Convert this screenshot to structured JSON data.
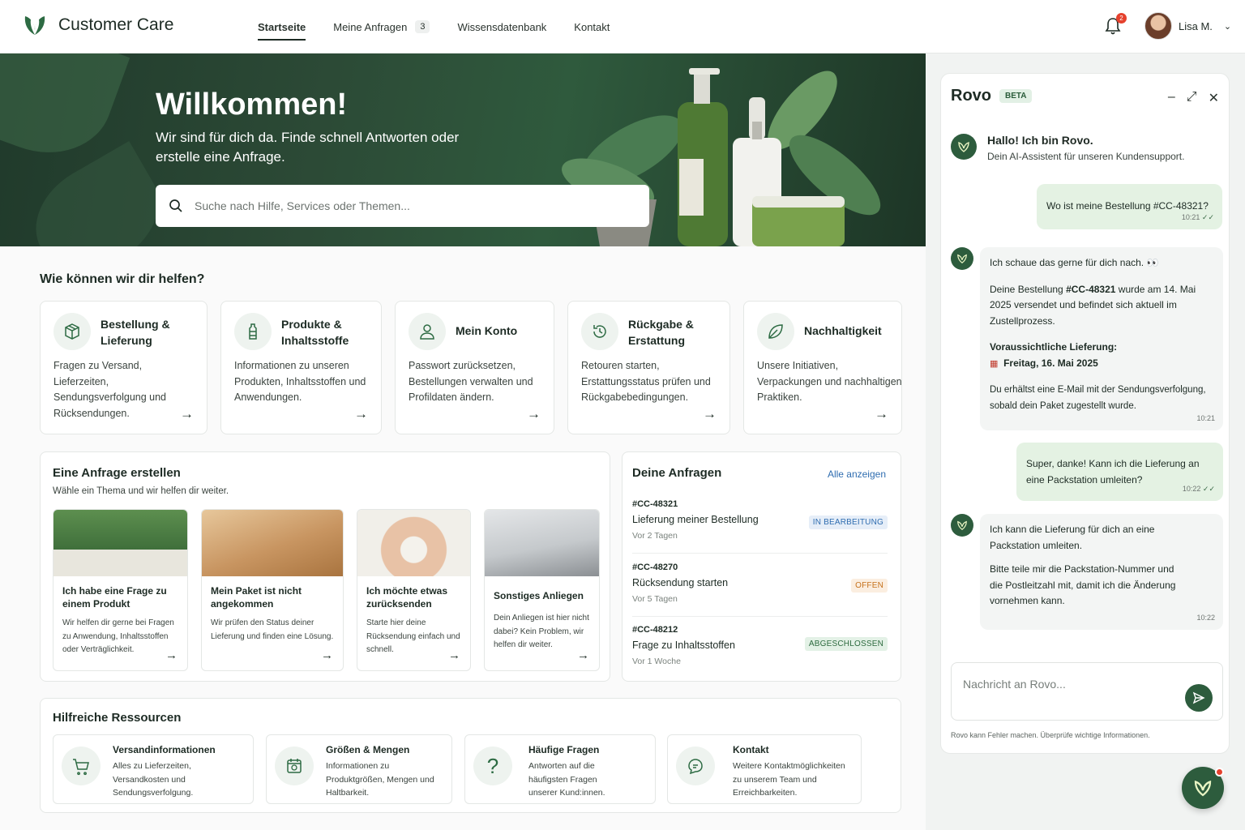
{
  "header": {
    "brand": "Customer Care",
    "nav": [
      {
        "label": "Startseite",
        "active": true
      },
      {
        "label": "Meine Anfragen",
        "badge": "3"
      },
      {
        "label": "Wissensdatenbank"
      },
      {
        "label": "Kontakt"
      }
    ],
    "notifications_count": "2",
    "user_name": "Lisa M."
  },
  "hero": {
    "title": "Willkommen!",
    "subtitle": "Wir sind für dich da. Finde schnell Antworten oder erstelle eine Anfrage.",
    "search_placeholder": "Suche nach Hilfe, Services oder Themen..."
  },
  "help": {
    "title": "Wie können wir dir helfen?",
    "categories": [
      {
        "title": "Bestellung & Lieferung",
        "desc": "Fragen zu Versand, Lieferzeiten, Sendungsverfolgung und Rücksendungen.",
        "icon": "package-icon"
      },
      {
        "title": "Produkte & Inhaltsstoffe",
        "desc": "Informationen zu unseren Produkten, Inhaltsstoffen und Anwendungen.",
        "icon": "bottle-icon"
      },
      {
        "title": "Mein Konto",
        "desc": "Passwort zurücksetzen, Bestellungen verwalten und Profildaten ändern.",
        "icon": "user-icon"
      },
      {
        "title": "Rückgabe & Erstattung",
        "desc": "Retouren starten, Erstattungsstatus prüfen und Rückgabebedingungen.",
        "icon": "return-icon"
      },
      {
        "title": "Nachhaltigkeit",
        "desc": "Unsere Initiativen, Verpackungen und nachhaltigen Praktiken.",
        "icon": "leaf-icon"
      }
    ]
  },
  "create_request": {
    "title": "Eine Anfrage erstellen",
    "subtitle": "Wähle ein Thema und wir helfen dir weiter.",
    "cards": [
      {
        "title": "Ich habe eine Frage zu einem Produkt",
        "desc": "Wir helfen dir gerne bei Fragen zu Anwendung, Inhaltsstoffen oder Verträglichkeit."
      },
      {
        "title": "Mein Paket ist nicht angekommen",
        "desc": "Wir prüfen den Status deiner Lieferung und finden eine Lösung."
      },
      {
        "title": "Ich möchte etwas zurücksenden",
        "desc": "Starte hier deine Rücksendung einfach und schnell."
      },
      {
        "title": "Sonstiges Anliegen",
        "desc": "Dein Anliegen ist hier nicht dabei? Kein Problem, wir helfen dir weiter."
      }
    ]
  },
  "my_requests": {
    "title": "Deine Anfragen",
    "show_all": "Alle anzeigen",
    "items": [
      {
        "id": "#CC-48321",
        "title": "Lieferung meiner Bestellung",
        "age": "Vor 2 Tagen",
        "status": "IN BEARBEITUNG",
        "status_color": "#2f6db0",
        "status_bg": "#e6eef8"
      },
      {
        "id": "#CC-48270",
        "title": "Rücksendung starten",
        "age": "Vor 5 Tagen",
        "status": "OFFEN",
        "status_color": "#c5711c",
        "status_bg": "#fbeee0"
      },
      {
        "id": "#CC-48212",
        "title": "Frage zu Inhaltsstoffen",
        "age": "Vor 1 Woche",
        "status": "ABGESCHLOSSEN",
        "status_color": "#2c6a3e",
        "status_bg": "#e3f1e6"
      }
    ]
  },
  "resources": {
    "title": "Hilfreiche Ressourcen",
    "items": [
      {
        "title": "Versandinformationen",
        "desc": "Alles zu Lieferzeiten, Versandkosten und Sendungsverfolgung.",
        "icon": "cart-icon"
      },
      {
        "title": "Größen & Mengen",
        "desc": "Informationen zu Produktgrößen, Mengen und Haltbarkeit.",
        "icon": "calendar-icon"
      },
      {
        "title": "Häufige Fragen",
        "desc": "Antworten auf die häufigsten Fragen unserer Kund:innen.",
        "icon": "question-icon"
      },
      {
        "title": "Kontakt",
        "desc": "Weitere Kontaktmöglichkeiten zu unserem Team und Erreichbarkeiten.",
        "icon": "chat-icon"
      }
    ]
  },
  "chat": {
    "title": "Rovo",
    "badge": "BETA",
    "greeting_title": "Hallo! Ich bin Rovo.",
    "greeting_sub": "Dein AI-Assistent für unseren Kundensupport.",
    "messages": [
      {
        "from": "user",
        "text": "Wo ist meine Bestellung #CC-48321?",
        "time": "10:21"
      },
      {
        "from": "bot",
        "line1": "Ich schaue das gerne für dich nach. 👀",
        "pre": "Deine Bestellung ",
        "order": "#CC-48321",
        "post": " wurde am 14. Mai 2025 versendet und befindet sich aktuell im Zustellprozess.",
        "delivery_label": "Voraussichtliche Lieferung:",
        "delivery_date": "Freitag, 16. Mai 2025",
        "note": "Du erhältst eine E-Mail mit der Sendungsverfolgung, sobald dein Paket zugestellt wurde.",
        "time": "10:21"
      },
      {
        "from": "user",
        "text": "Super, danke! Kann ich die Lieferung an eine Packstation umleiten?",
        "time": "10:22"
      },
      {
        "from": "bot",
        "line1": "Ich kann die Lieferung für dich an eine Packstation umleiten.",
        "line2": "Bitte teile mir die Packstation-Nummer und die Postleitzahl mit, damit ich die Änderung vornehmen kann.",
        "time": "10:22"
      }
    ],
    "input_placeholder": "Nachricht an Rovo...",
    "disclaimer": "Rovo kann Fehler machen. Überprüfe wichtige Informationen."
  },
  "colors": {
    "brand_green": "#2d5c3d",
    "accent_blue": "#2f6db0"
  }
}
